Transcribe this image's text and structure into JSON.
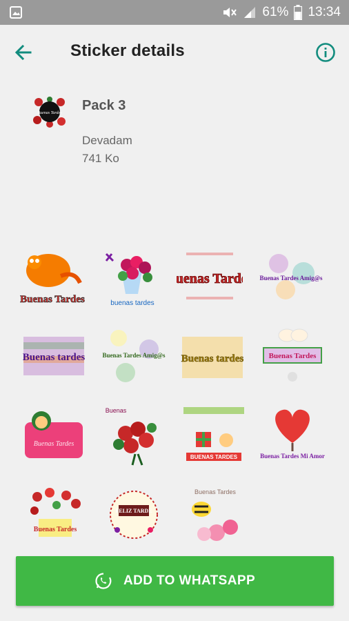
{
  "status_bar": {
    "battery": "61%",
    "time": "13:34",
    "icons": [
      "gallery-icon",
      "mute-icon",
      "signal-icon",
      "battery-icon"
    ]
  },
  "toolbar": {
    "title": "Sticker details",
    "back_icon": "arrow-left-icon",
    "info_icon": "info-icon",
    "accent_color": "#128c7e"
  },
  "pack": {
    "name": "Pack 3",
    "author": "Devadam",
    "size": "741 Ko",
    "tray_text": "Buenas Tardes"
  },
  "stickers": [
    {
      "text": "Buenas Tardes"
    },
    {
      "text": "buenas tardes"
    },
    {
      "text": "Buenas Tardes"
    },
    {
      "text": "Buenas Tardes Amig@s"
    },
    {
      "text": "Buenas tardes"
    },
    {
      "text": "Buenas Tardes Amig@s"
    },
    {
      "text": "Buenas tardes"
    },
    {
      "text": "Buenas Tardes"
    },
    {
      "text": "Buenas Tardes"
    },
    {
      "text": "Buenas"
    },
    {
      "text": "BUENAS TARDES"
    },
    {
      "text": "Buenas Tardes Mi Amor"
    },
    {
      "text": "Buenas Tardes"
    },
    {
      "text": "FELIZ TARDE"
    },
    {
      "text": "Buenas Tardes"
    }
  ],
  "add_button": {
    "label": "ADD TO WHATSAPP",
    "icon": "whatsapp-icon",
    "color": "#40b845"
  }
}
